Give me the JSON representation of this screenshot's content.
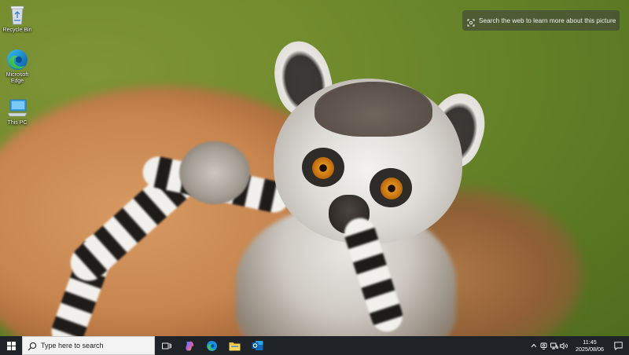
{
  "desktop": {
    "icons": [
      {
        "label": "Recycle Bin",
        "icon": "recycle-bin-icon"
      },
      {
        "label": "Microsoft Edge",
        "icon": "edge-icon"
      },
      {
        "label": "This PC",
        "icon": "this-pc-icon"
      }
    ],
    "info_pill": {
      "label": "Search the web to learn more about this picture",
      "icon": "image-search-icon"
    }
  },
  "taskbar": {
    "search_placeholder": "Type here to search",
    "apps": [
      {
        "name": "Task View",
        "icon": "task-view-icon"
      },
      {
        "name": "Copilot",
        "icon": "copilot-icon"
      },
      {
        "name": "Microsoft Edge",
        "icon": "edge-icon"
      },
      {
        "name": "File Explorer",
        "icon": "folder-icon"
      },
      {
        "name": "Outlook",
        "icon": "outlook-icon"
      }
    ],
    "tray": {
      "icons": [
        "chevron-up-icon",
        "meet-now-icon",
        "network-icon",
        "volume-icon"
      ],
      "time": "11:45",
      "date": "2025/08/06"
    }
  },
  "colors": {
    "taskbar": "#1f2328",
    "search_box": "#f3f3f3",
    "wallpaper_green": "#6f8a2c",
    "edge_blue": "#0c7bd8",
    "outlook_blue": "#0f6cbd",
    "folder_yellow": "#f3c13b"
  }
}
